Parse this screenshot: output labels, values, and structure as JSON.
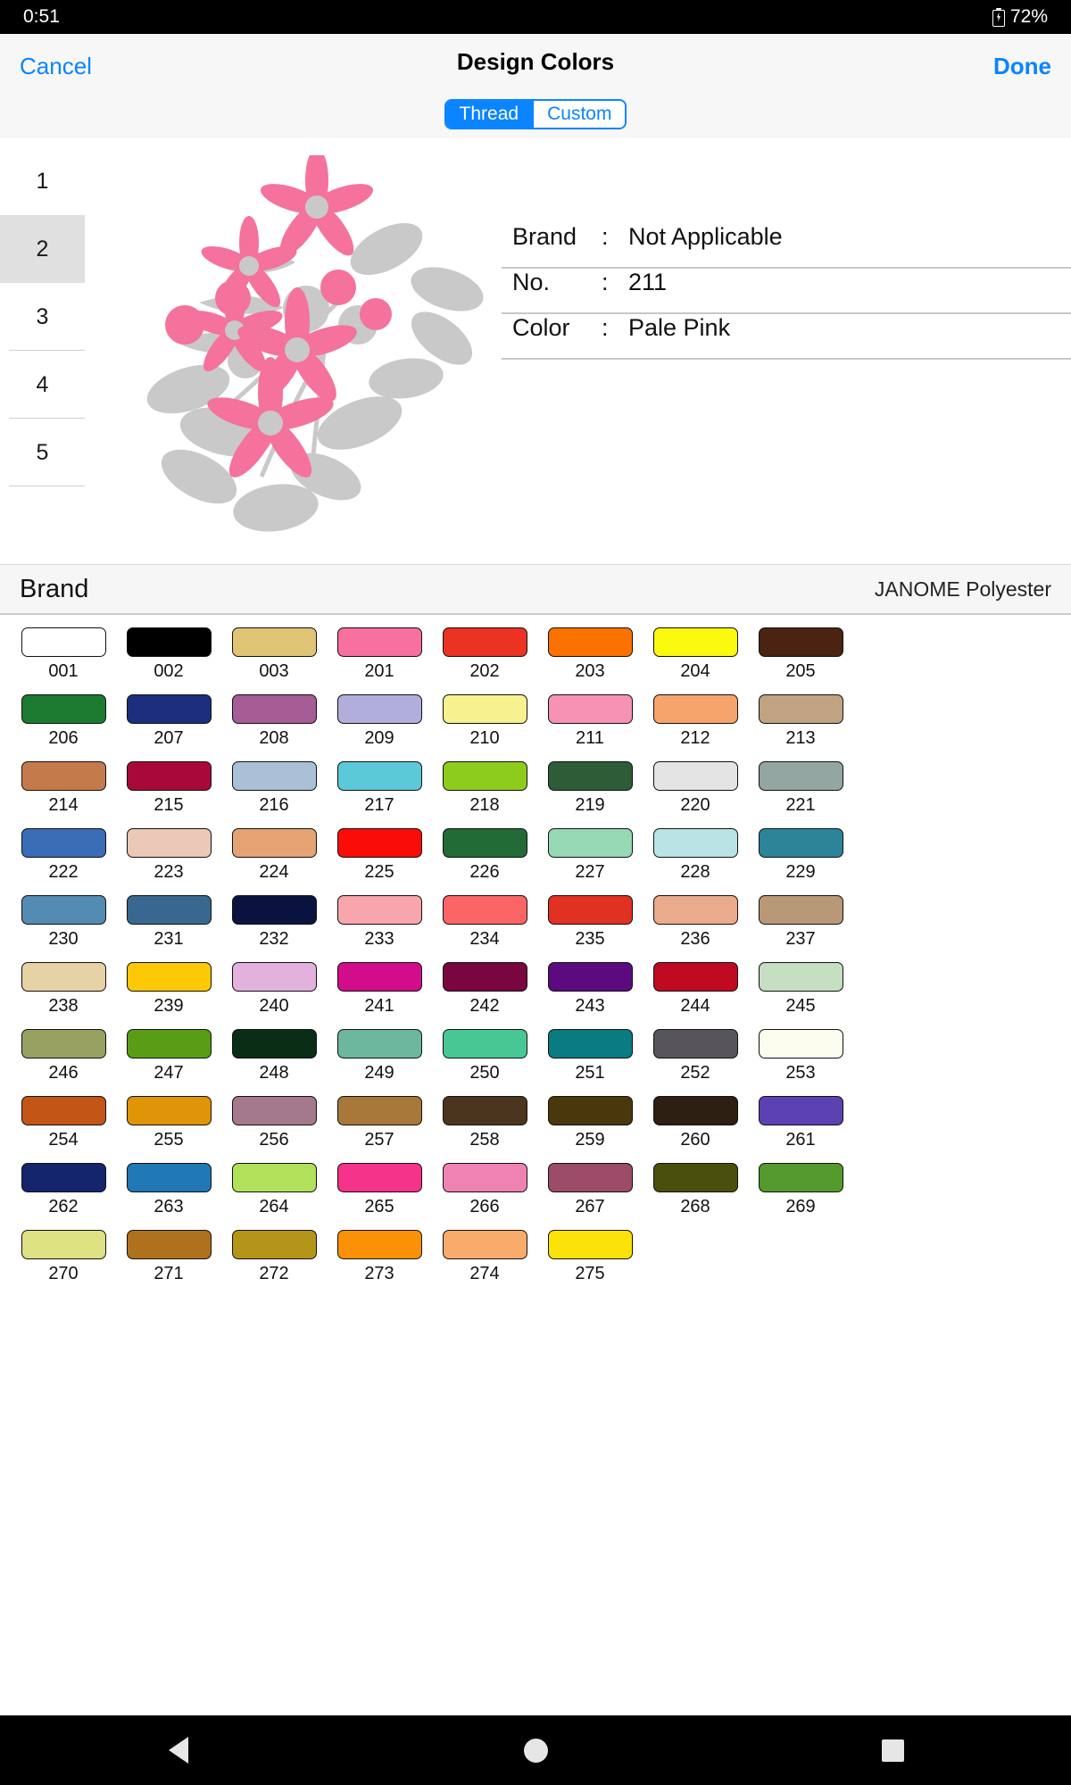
{
  "status_bar": {
    "time": "0:51",
    "battery_percent": "72%",
    "battery_icon": "battery-charging-icon"
  },
  "nav": {
    "cancel_label": "Cancel",
    "title": "Design Colors",
    "done_label": "Done",
    "accent_color": "#0a84ff"
  },
  "segmented": {
    "options": [
      {
        "label": "Thread",
        "active": true
      },
      {
        "label": "Custom",
        "active": false
      }
    ]
  },
  "layers": {
    "items": [
      "1",
      "2",
      "3",
      "4",
      "5"
    ],
    "selected_index": 1
  },
  "preview": {
    "alt": "floral-embroidery-design",
    "highlight_color": "#f4729c",
    "inactive_color": "#c9c9c9"
  },
  "details": {
    "rows": [
      {
        "label": "Brand",
        "colon": ":",
        "value": "Not Applicable"
      },
      {
        "label": "No.",
        "colon": ":",
        "value": "211"
      },
      {
        "label": "Color",
        "colon": ":",
        "value": "Pale Pink"
      }
    ]
  },
  "brand_header": {
    "title": "Brand",
    "value": "JANOME Polyester"
  },
  "palette": {
    "rows": [
      [
        {
          "code": "001",
          "hex": "#ffffff"
        },
        {
          "code": "002",
          "hex": "#000000"
        },
        {
          "code": "003",
          "hex": "#e0c476"
        },
        {
          "code": "201",
          "hex": "#f7709f"
        },
        {
          "code": "202",
          "hex": "#ea3323"
        },
        {
          "code": "203",
          "hex": "#fb7200"
        },
        {
          "code": "204",
          "hex": "#fbf90d"
        },
        {
          "code": "205",
          "hex": "#4a2312"
        }
      ],
      [
        {
          "code": "206",
          "hex": "#1d7a31"
        },
        {
          "code": "207",
          "hex": "#1d2f7c"
        },
        {
          "code": "208",
          "hex": "#a65c94"
        },
        {
          "code": "209",
          "hex": "#b1aedb"
        },
        {
          "code": "210",
          "hex": "#f7f190"
        },
        {
          "code": "211",
          "hex": "#f693b4"
        },
        {
          "code": "212",
          "hex": "#f7a46c"
        },
        {
          "code": "213",
          "hex": "#c0a383"
        }
      ],
      [
        {
          "code": "214",
          "hex": "#c57a4c"
        },
        {
          "code": "215",
          "hex": "#a8083a"
        },
        {
          "code": "216",
          "hex": "#a9c0d7"
        },
        {
          "code": "217",
          "hex": "#5cc9d9"
        },
        {
          "code": "218",
          "hex": "#8dcc1d"
        },
        {
          "code": "219",
          "hex": "#2d5c36"
        },
        {
          "code": "220",
          "hex": "#e4e4e4"
        },
        {
          "code": "221",
          "hex": "#93a6a2"
        }
      ],
      [
        {
          "code": "222",
          "hex": "#3b6cb6"
        },
        {
          "code": "223",
          "hex": "#ecc8b8"
        },
        {
          "code": "224",
          "hex": "#e5a272"
        },
        {
          "code": "225",
          "hex": "#fa0d07"
        },
        {
          "code": "226",
          "hex": "#226b37"
        },
        {
          "code": "227",
          "hex": "#96d9b4"
        },
        {
          "code": "228",
          "hex": "#b9e3e4"
        },
        {
          "code": "229",
          "hex": "#2c8498"
        }
      ],
      [
        {
          "code": "230",
          "hex": "#538bb3"
        },
        {
          "code": "231",
          "hex": "#38688f"
        },
        {
          "code": "232",
          "hex": "#0a1340"
        },
        {
          "code": "233",
          "hex": "#f9a5ac"
        },
        {
          "code": "234",
          "hex": "#fb6565"
        },
        {
          "code": "235",
          "hex": "#e03122"
        },
        {
          "code": "236",
          "hex": "#eaaa8c"
        },
        {
          "code": "237",
          "hex": "#b99878"
        }
      ],
      [
        {
          "code": "238",
          "hex": "#e6d2a5"
        },
        {
          "code": "239",
          "hex": "#fdc806"
        },
        {
          "code": "240",
          "hex": "#e3b1dd"
        },
        {
          "code": "241",
          "hex": "#d30c8c"
        },
        {
          "code": "242",
          "hex": "#79063f"
        },
        {
          "code": "243",
          "hex": "#5b0a80"
        },
        {
          "code": "244",
          "hex": "#c00a22"
        },
        {
          "code": "245",
          "hex": "#c6dfc2"
        }
      ],
      [
        {
          "code": "246",
          "hex": "#97a061"
        },
        {
          "code": "247",
          "hex": "#599d17"
        },
        {
          "code": "248",
          "hex": "#0a2d16"
        },
        {
          "code": "249",
          "hex": "#6cb79e"
        },
        {
          "code": "250",
          "hex": "#48c794"
        },
        {
          "code": "251",
          "hex": "#0a7b80"
        },
        {
          "code": "252",
          "hex": "#575559"
        },
        {
          "code": "253",
          "hex": "#fcfcef"
        }
      ],
      [
        {
          "code": "254",
          "hex": "#c35517"
        },
        {
          "code": "255",
          "hex": "#df9507"
        },
        {
          "code": "256",
          "hex": "#a5798c"
        },
        {
          "code": "257",
          "hex": "#a8783a"
        },
        {
          "code": "258",
          "hex": "#4c351f"
        },
        {
          "code": "259",
          "hex": "#4a380d"
        },
        {
          "code": "260",
          "hex": "#2d1f12"
        },
        {
          "code": "261",
          "hex": "#5c41b3"
        }
      ],
      [
        {
          "code": "262",
          "hex": "#14246d"
        },
        {
          "code": "263",
          "hex": "#2079b5"
        },
        {
          "code": "264",
          "hex": "#b1e05b"
        },
        {
          "code": "265",
          "hex": "#f5338a"
        },
        {
          "code": "266",
          "hex": "#ef82b3"
        },
        {
          "code": "267",
          "hex": "#9c4b68"
        },
        {
          "code": "268",
          "hex": "#4b4f0c"
        },
        {
          "code": "269",
          "hex": "#549a2c"
        }
      ],
      [
        {
          "code": "270",
          "hex": "#dde181"
        },
        {
          "code": "271",
          "hex": "#b0711d"
        },
        {
          "code": "272",
          "hex": "#b59517"
        },
        {
          "code": "273",
          "hex": "#fb9106"
        },
        {
          "code": "274",
          "hex": "#f8ab6a"
        },
        {
          "code": "275",
          "hex": "#fbe208"
        }
      ]
    ]
  },
  "android_nav": {
    "back_icon": "back-triangle-icon",
    "home_icon": "home-circle-icon",
    "recents_icon": "recents-square-icon"
  }
}
